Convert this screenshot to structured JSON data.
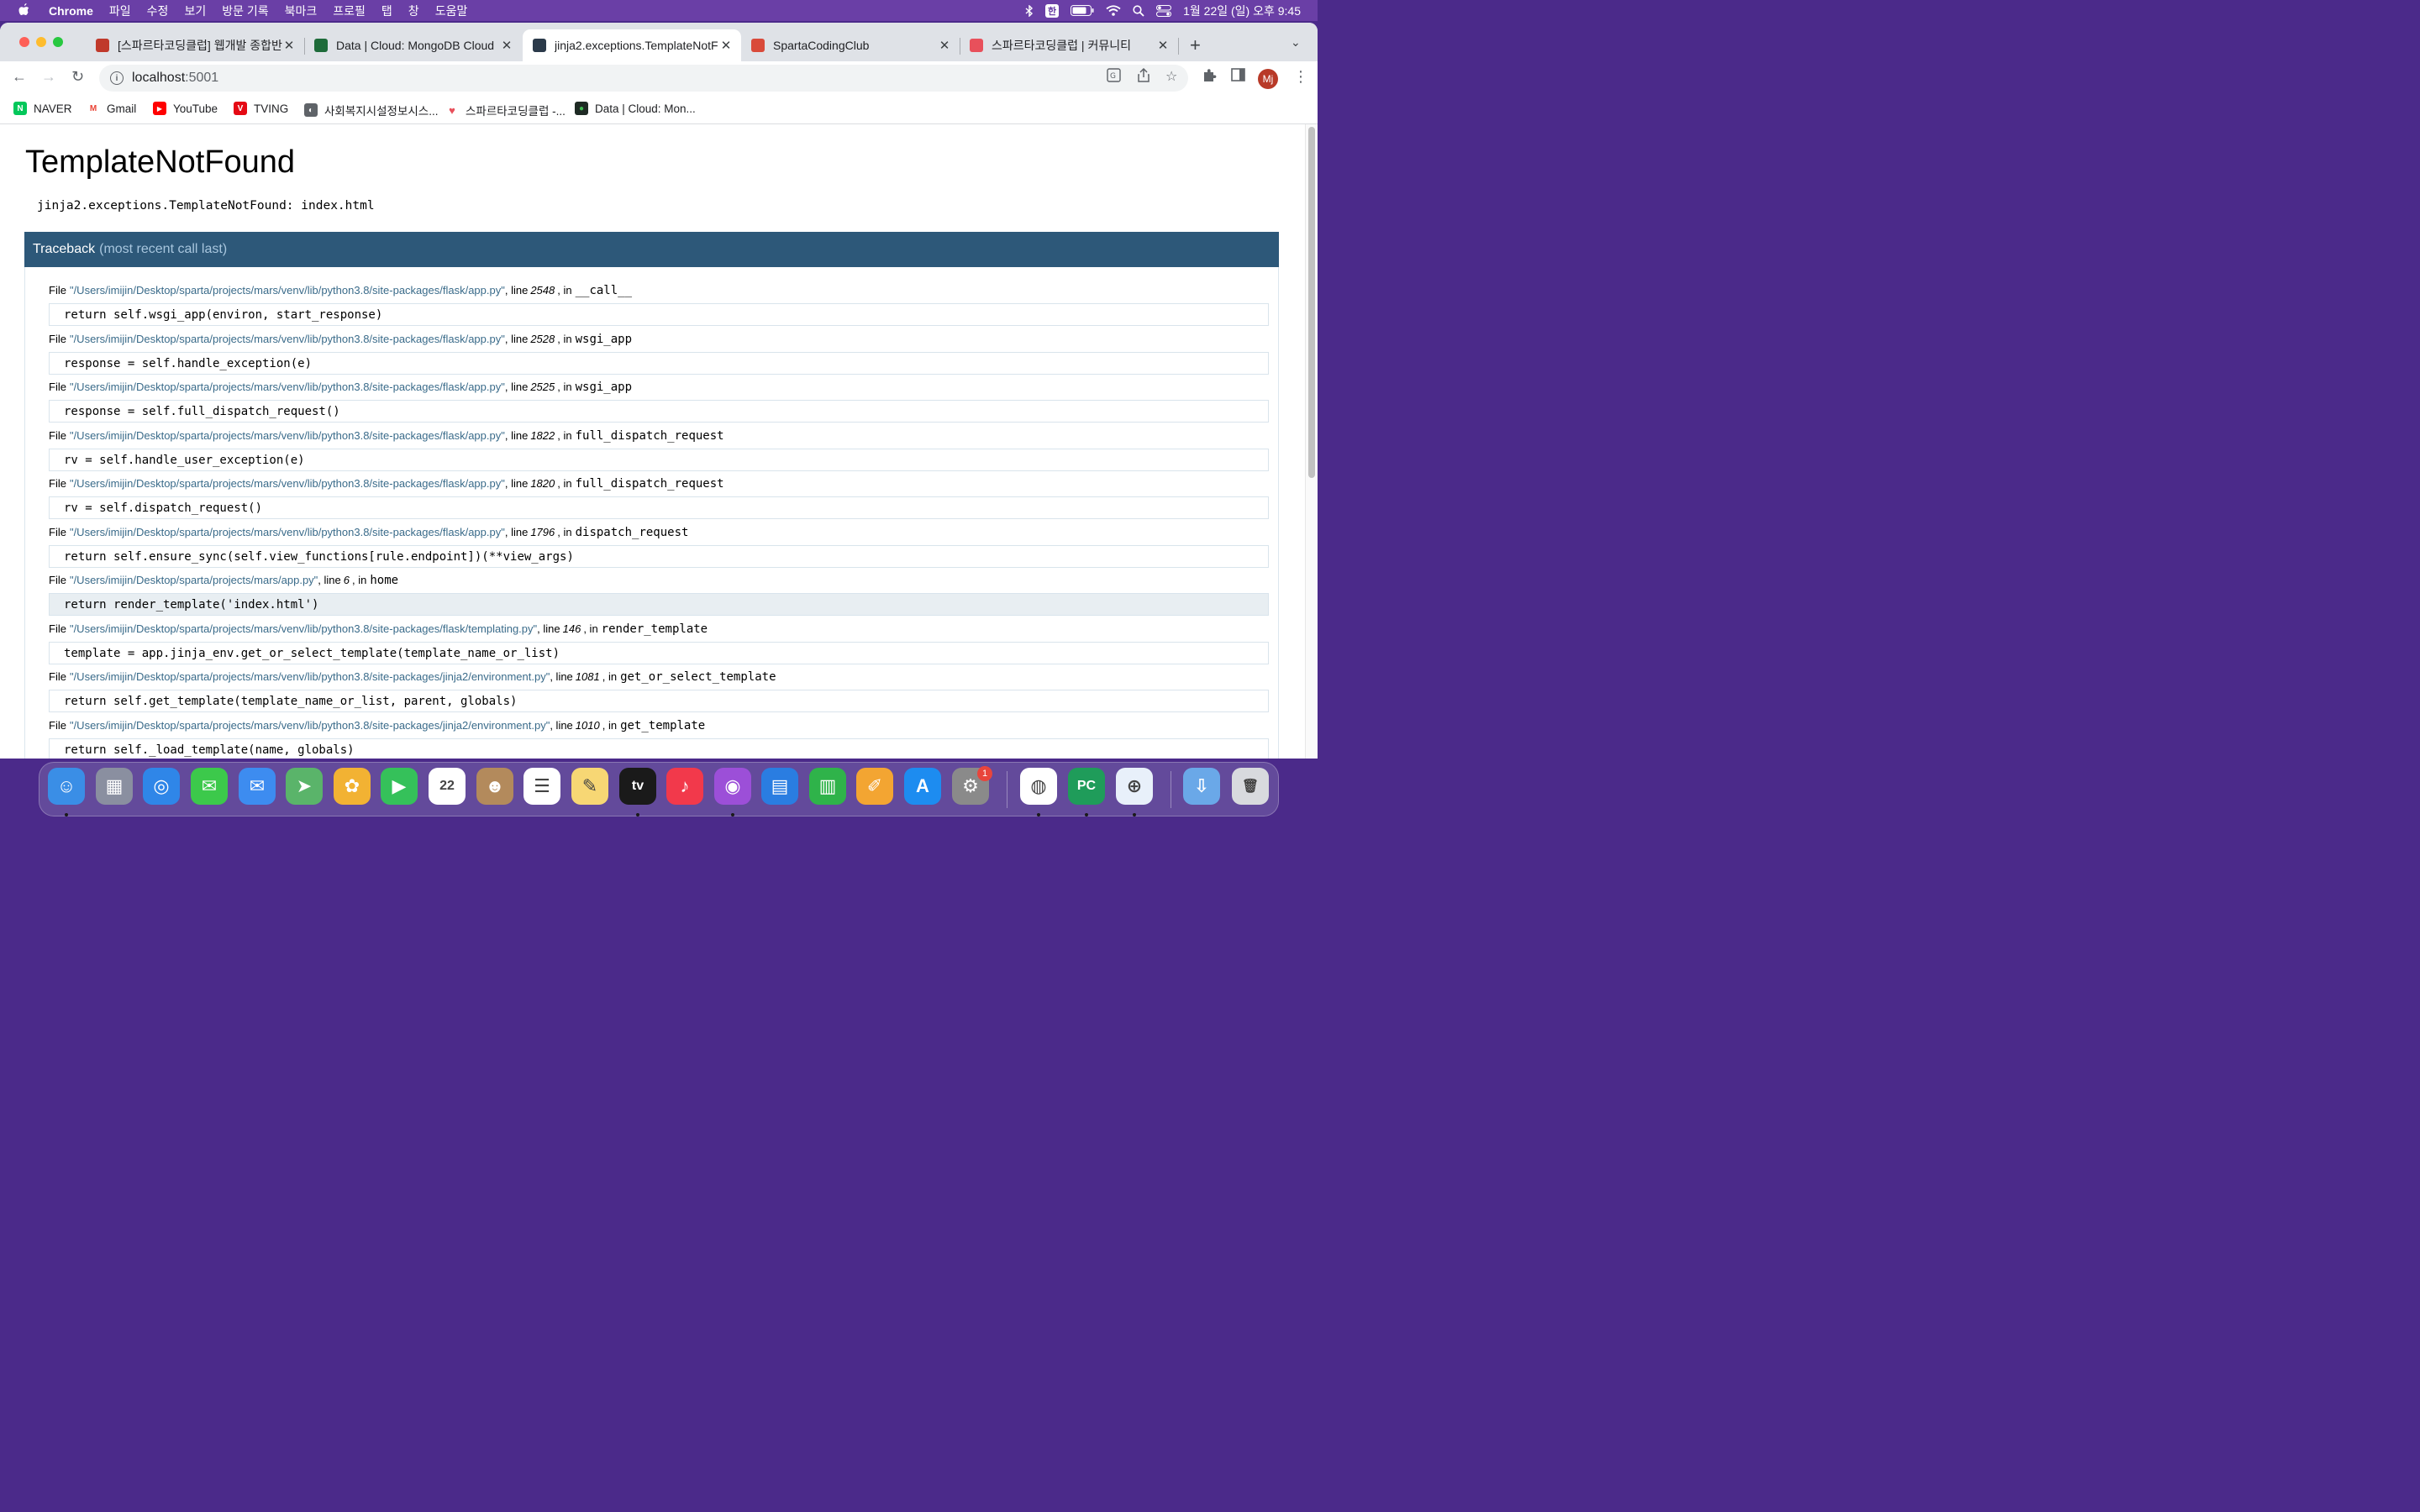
{
  "menubar": {
    "app_name": "Chrome",
    "items": [
      "파일",
      "수정",
      "보기",
      "방문 기록",
      "북마크",
      "프로필",
      "탭",
      "창",
      "도움말"
    ],
    "ime_label": "한",
    "clock": "1월 22일 (일) 오후 9:45"
  },
  "tabs": [
    {
      "title": "[스파르타코딩클럽] 웹개발 종합반 -",
      "favicon_color": "#c0392b",
      "active": false
    },
    {
      "title": "Data | Cloud: MongoDB Cloud",
      "favicon_color": "#1e6b3a",
      "active": false
    },
    {
      "title": "jinja2.exceptions.TemplateNotF",
      "favicon_color": "#2b3a4a",
      "active": true
    },
    {
      "title": "SpartaCodingClub",
      "favicon_color": "#d94a3a",
      "active": false
    },
    {
      "title": "스파르타코딩클럽 | 커뮤니티",
      "favicon_color": "#e8505b",
      "active": false
    }
  ],
  "toolbar": {
    "url_host": "localhost",
    "url_port": ":5001",
    "avatar_initials": "Mj"
  },
  "bookmarks": [
    {
      "label": "NAVER",
      "color": "#03c75a",
      "glyph": "N"
    },
    {
      "label": "Gmail",
      "color": "#ea4335",
      "glyph": "M"
    },
    {
      "label": "YouTube",
      "color": "#ff0000",
      "glyph": "▶"
    },
    {
      "label": "TVING",
      "color": "#e50914",
      "glyph": "V"
    },
    {
      "label": "사회복지시설정보시스...",
      "color": "#5f6368",
      "glyph": "◐"
    },
    {
      "label": "스파르타코딩클럽 -...",
      "color": "#e8505b",
      "glyph": "♥"
    },
    {
      "label": "Data | Cloud: Mon...",
      "color": "#1e6b3a",
      "glyph": "●"
    }
  ],
  "page": {
    "title": "TemplateNotFound",
    "message": "jinja2.exceptions.TemplateNotFound: index.html",
    "traceback_label": "Traceback",
    "traceback_sub": "(most recent call last)",
    "file_prefix": "File",
    "line_word": ", line",
    "in_word": ", in",
    "frames": [
      {
        "path": "\"/Users/imijin/Desktop/sparta/projects/mars/venv/lib/python3.8/site-packages/flask/app.py\"",
        "line": "2548",
        "func": "__call__",
        "code": "return self.wsgi_app(environ, start_response)"
      },
      {
        "path": "\"/Users/imijin/Desktop/sparta/projects/mars/venv/lib/python3.8/site-packages/flask/app.py\"",
        "line": "2528",
        "func": "wsgi_app",
        "code": "response = self.handle_exception(e)"
      },
      {
        "path": "\"/Users/imijin/Desktop/sparta/projects/mars/venv/lib/python3.8/site-packages/flask/app.py\"",
        "line": "2525",
        "func": "wsgi_app",
        "code": "response = self.full_dispatch_request()"
      },
      {
        "path": "\"/Users/imijin/Desktop/sparta/projects/mars/venv/lib/python3.8/site-packages/flask/app.py\"",
        "line": "1822",
        "func": "full_dispatch_request",
        "code": "rv = self.handle_user_exception(e)"
      },
      {
        "path": "\"/Users/imijin/Desktop/sparta/projects/mars/venv/lib/python3.8/site-packages/flask/app.py\"",
        "line": "1820",
        "func": "full_dispatch_request",
        "code": "rv = self.dispatch_request()"
      },
      {
        "path": "\"/Users/imijin/Desktop/sparta/projects/mars/venv/lib/python3.8/site-packages/flask/app.py\"",
        "line": "1796",
        "func": "dispatch_request",
        "code": "return self.ensure_sync(self.view_functions[rule.endpoint])(**view_args)"
      },
      {
        "path": "\"/Users/imijin/Desktop/sparta/projects/mars/app.py\"",
        "line": "6",
        "func": "home",
        "code": "return render_template('index.html')",
        "highlight": true
      },
      {
        "path": "\"/Users/imijin/Desktop/sparta/projects/mars/venv/lib/python3.8/site-packages/flask/templating.py\"",
        "line": "146",
        "func": "render_template",
        "code": "template = app.jinja_env.get_or_select_template(template_name_or_list)"
      },
      {
        "path": "\"/Users/imijin/Desktop/sparta/projects/mars/venv/lib/python3.8/site-packages/jinja2/environment.py\"",
        "line": "1081",
        "func": "get_or_select_template",
        "code": "return self.get_template(template_name_or_list, parent, globals)"
      },
      {
        "path": "\"/Users/imijin/Desktop/sparta/projects/mars/venv/lib/python3.8/site-packages/jinja2/environment.py\"",
        "line": "1010",
        "func": "get_template",
        "code": "return self._load_template(name, globals)"
      }
    ]
  },
  "dock": {
    "apps": [
      {
        "name": "finder",
        "color": "#3a8ee6",
        "glyph": "☺",
        "running": true
      },
      {
        "name": "launchpad",
        "color": "#8a8fa0",
        "glyph": "▦",
        "running": false
      },
      {
        "name": "safari",
        "color": "#2f86e8",
        "glyph": "◎",
        "running": false
      },
      {
        "name": "messages",
        "color": "#3cc94b",
        "glyph": "✉",
        "running": false
      },
      {
        "name": "mail",
        "color": "#3d8cf0",
        "glyph": "✉",
        "running": false
      },
      {
        "name": "maps",
        "color": "#5ab46a",
        "glyph": "➤",
        "running": false
      },
      {
        "name": "photos",
        "color": "#f2b233",
        "glyph": "✿",
        "running": false
      },
      {
        "name": "facetime",
        "color": "#35c15a",
        "glyph": "▶",
        "running": false
      },
      {
        "name": "calendar",
        "color": "#ffffff",
        "glyph": "22",
        "running": false
      },
      {
        "name": "contacts",
        "color": "#b38a5c",
        "glyph": "☻",
        "running": false
      },
      {
        "name": "reminders",
        "color": "#ffffff",
        "glyph": "☰",
        "running": false
      },
      {
        "name": "notes",
        "color": "#f7d774",
        "glyph": "✎",
        "running": false
      },
      {
        "name": "apple-tv",
        "color": "#1a1a1a",
        "glyph": "tv",
        "running": true
      },
      {
        "name": "music",
        "color": "#f2394b",
        "glyph": "♪",
        "running": false
      },
      {
        "name": "podcasts",
        "color": "#9c4fd8",
        "glyph": "◉",
        "running": true
      },
      {
        "name": "keynote",
        "color": "#2a7de1",
        "glyph": "▤",
        "running": false
      },
      {
        "name": "numbers",
        "color": "#2fb34a",
        "glyph": "▥",
        "running": false
      },
      {
        "name": "pages",
        "color": "#f3a532",
        "glyph": "✐",
        "running": false
      },
      {
        "name": "app-store",
        "color": "#1d8cf0",
        "glyph": "A",
        "running": false
      },
      {
        "name": "system-preferences",
        "color": "#8a8a8a",
        "glyph": "⚙",
        "running": false,
        "badge": "1"
      },
      {
        "name": "chrome",
        "color": "#ffffff",
        "glyph": "◍",
        "running": true
      },
      {
        "name": "pycharm",
        "color": "#1f9c5a",
        "glyph": "PC",
        "running": true
      },
      {
        "name": "extra-app",
        "color": "#e8f0fa",
        "glyph": "⊕",
        "running": true
      },
      {
        "name": "downloads-folder",
        "color": "#6aa8e8",
        "glyph": "⇩",
        "running": false
      },
      {
        "name": "trash",
        "color": "#d8dade",
        "glyph": "🗑",
        "running": false
      }
    ]
  }
}
